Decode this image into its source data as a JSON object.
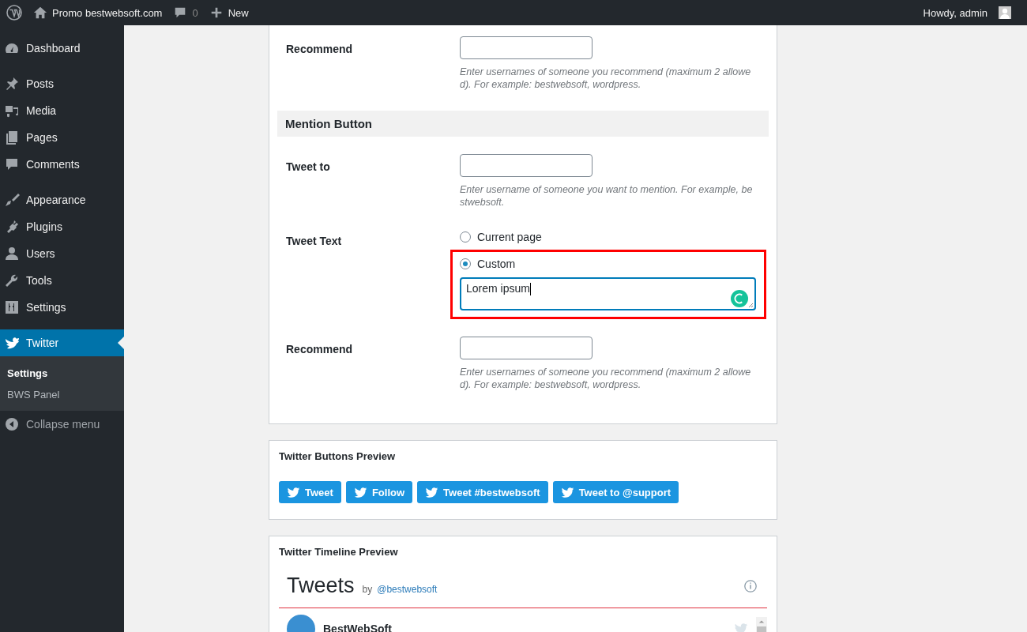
{
  "admin_bar": {
    "site_name": "Promo bestwebsoft.com",
    "comments_count": "0",
    "new_label": "New",
    "greeting": "Howdy, admin"
  },
  "sidebar": {
    "items": [
      {
        "label": "Dashboard",
        "selected": false
      },
      {
        "label": "Posts",
        "selected": false
      },
      {
        "label": "Media",
        "selected": false
      },
      {
        "label": "Pages",
        "selected": false
      },
      {
        "label": "Comments",
        "selected": false
      },
      {
        "label": "Appearance",
        "selected": false
      },
      {
        "label": "Plugins",
        "selected": false
      },
      {
        "label": "Users",
        "selected": false
      },
      {
        "label": "Tools",
        "selected": false
      },
      {
        "label": "Settings",
        "selected": false
      },
      {
        "label": "Twitter",
        "selected": true,
        "children": [
          {
            "label": "Settings",
            "selected": true
          },
          {
            "label": "BWS Panel",
            "selected": false
          }
        ]
      }
    ],
    "collapse_label": "Collapse menu"
  },
  "settings": {
    "recommend_top": {
      "label": "Recommend",
      "help": "Enter usernames of someone you recommend (maximum 2 allowe d). For example: bestwebsoft, wordpress."
    },
    "section_title": "Mention Button",
    "tweet_to": {
      "label": "Tweet to",
      "help": "Enter username of someone you want to mention. For example, be stwebsoft."
    },
    "tweet_text": {
      "label": "Tweet Text",
      "options": [
        {
          "label": "Current page",
          "selected": false
        },
        {
          "label": "Custom",
          "selected": true
        }
      ],
      "custom_value": "Lorem ipsum"
    },
    "recommend": {
      "label": "Recommend",
      "help": "Enter usernames of someone you recommend (maximum 2 allowe d). For example: bestwebsoft, wordpress."
    }
  },
  "buttons_preview": {
    "title": "Twitter Buttons Preview",
    "buttons": [
      "Tweet",
      "Follow",
      "Tweet #bestwebsoft",
      "Tweet to @support"
    ]
  },
  "timeline_preview": {
    "title": "Twitter Timeline Preview",
    "heading": "Tweets",
    "by": "by",
    "handle": "@bestwebsoft",
    "first_author": "BestWebSoft"
  }
}
